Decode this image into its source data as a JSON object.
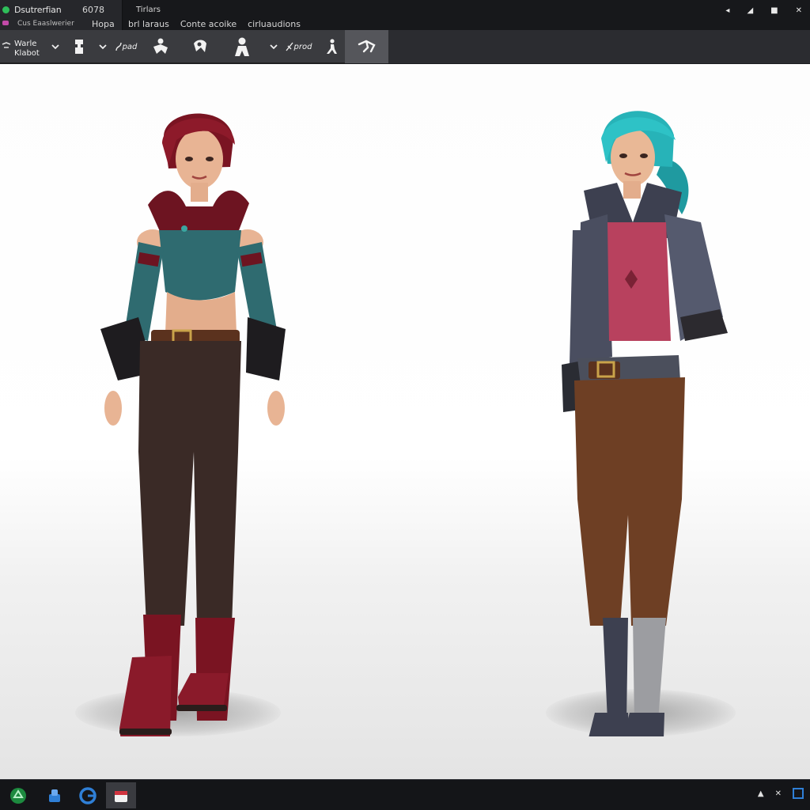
{
  "titlebar": {
    "app_name": "Dsutrerfian",
    "version": "6078",
    "subtitle": "Cus Eaaslwerier",
    "doc_label": "Hopa",
    "top_menu": "Tirlars",
    "menu": [
      "brl laraus",
      "Conte acoike",
      "cirluaudions"
    ]
  },
  "toolbar": {
    "mode_label_line1": "Warle",
    "mode_label_line2": "Klabot",
    "tool1_text": "pad",
    "tool2_text": "prod",
    "active_tool": "pose-tool"
  },
  "viewport": {
    "background": "#ffffff",
    "characters": [
      {
        "name": "character-left",
        "hair_color": "#7a1422",
        "top_color": "#2f6b70",
        "pants_color": "#3a2a26",
        "boots_color": "#8a1a2a"
      },
      {
        "name": "character-right",
        "hair_color": "#27b3b8",
        "top_color": "#b8415e",
        "pants_color": "#6e3f24",
        "boots_color": "#3d4050"
      }
    ]
  },
  "taskbar": {
    "apps": [
      "recycle-icon",
      "app-icon",
      "browser-icon",
      "editor-icon"
    ],
    "active_app": "editor-icon"
  },
  "colors": {
    "titlebar": "#17181b",
    "toolbar": "#3a3b3f",
    "taskbar": "#141518",
    "accent": "#2f7fd6"
  }
}
